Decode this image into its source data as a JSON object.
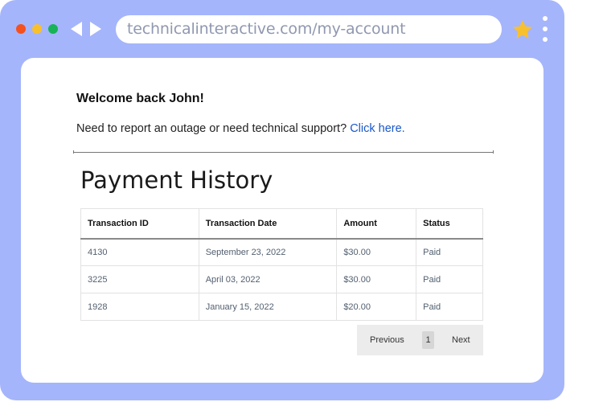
{
  "browser": {
    "url": "technicalinteractive.com/my-account",
    "colors": {
      "frame": "#a5b5fb",
      "close": "#f4511e",
      "minimize": "#f9c02d",
      "maximize": "#17b356",
      "star": "#f9c02d"
    },
    "icons": [
      "back-arrow-icon",
      "forward-arrow-icon",
      "star-icon",
      "kebab-menu-icon"
    ]
  },
  "account": {
    "welcome": "Welcome  back John!",
    "support_text": "Need to report an outage or need technical support? ",
    "support_link": "Click here.",
    "heading": "Payment History",
    "link_color": "#1957c9"
  },
  "table": {
    "headers": {
      "id": "Transaction ID",
      "date": "Transaction Date",
      "amount": "Amount",
      "status": "Status"
    },
    "rows": [
      {
        "id": "4130",
        "date": "September 23, 2022",
        "amount": "$30.00",
        "status": "Paid"
      },
      {
        "id": "3225",
        "date": "April 03, 2022",
        "amount": "$30.00",
        "status": "Paid"
      },
      {
        "id": "1928",
        "date": "January 15, 2022",
        "amount": "$20.00",
        "status": "Paid"
      }
    ]
  },
  "pagination": {
    "previous": "Previous",
    "current_page": "1",
    "next": "Next"
  }
}
